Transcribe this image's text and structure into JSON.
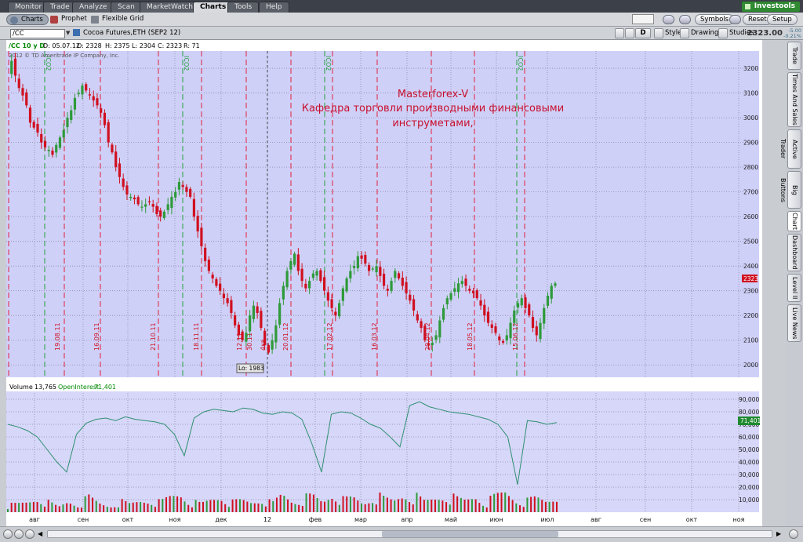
{
  "top_tabs": [
    {
      "label": "Monitor"
    },
    {
      "label": "Trade"
    },
    {
      "label": "Analyze"
    },
    {
      "label": "Scan"
    },
    {
      "label": "MarketWatch"
    },
    {
      "label": "Charts",
      "active": true
    },
    {
      "label": "Tools"
    },
    {
      "label": "Help"
    }
  ],
  "brand": "Investools",
  "sub_tabs": [
    {
      "label": "Charts",
      "active": true
    },
    {
      "label": "Prophet"
    },
    {
      "label": "Flexible Grid"
    }
  ],
  "sub_buttons": {
    "symbols": "Symbols",
    "reset": "Reset",
    "setup": "Setup"
  },
  "symbol_bar": {
    "symbol": "/CC",
    "description": "Cocoa Futures,ETH (SEP2 12)",
    "period": "D",
    "style": "Style",
    "drawings": "Drawings",
    "studies": "Studies",
    "last_price": "2323.00",
    "change_abs": "-5.00",
    "change_pct": "-0.21%"
  },
  "info_bar": {
    "agg": "/CC 10 y D",
    "date": "D: 05.07.12",
    "open": "O: 2328",
    "high": "H: 2375",
    "low": "L: 2304",
    "close": "C: 2323",
    "range": "R: 71",
    "copyright": "2012 © TD Ameritrade IP Company, Inc."
  },
  "annotation": {
    "line1": "Masterforex-V",
    "line2": "Кафедра торговли производными финансовыми",
    "line3": "инструметами,"
  },
  "low_label": "Lo: 1983",
  "price_tag": "2323",
  "date_marks": [
    "19.08.11",
    "16.09.11",
    "21.10.11",
    "18.11.11",
    "12.11",
    "30.11",
    "4кв",
    "20.01.12",
    "17.02.12",
    "16.03.12",
    "20.04.12",
    "18.05.12",
    "15.06.12"
  ],
  "vertical_texts": [
    "ICO2",
    "ICO2",
    "ICO2",
    "ICO2"
  ],
  "volume_header": {
    "volume_label": "Volume",
    "volume_value": "13,765",
    "oi_label": "OpenInterest",
    "oi_value": "71,401"
  },
  "oi_tag": "71,401",
  "x_labels": [
    "авг",
    "сен",
    "окт",
    "ноя",
    "дек",
    "12",
    "фев",
    "мар",
    "апр",
    "май",
    "июн",
    "июл",
    "авг",
    "сен",
    "окт",
    "ноя"
  ],
  "side_tabs": [
    "Trade",
    "Times And Sales",
    "Active Trader",
    "Big Buttons",
    "Chart",
    "Dashboard",
    "Level II",
    "Live News"
  ],
  "colors": {
    "up": "#2e9a3a",
    "down": "#d01020",
    "bg_price": "#cfd0f8",
    "bg_vol": "#d6d7f9",
    "grid": "#777777",
    "vline_red": "#e0203a",
    "vline_green": "#23a23a",
    "annotation": "#c8102e",
    "oi_line": "#2f8f6f"
  },
  "chart_data": [
    {
      "type": "candlestick",
      "title": "/CC 10 y D",
      "ylim": [
        1950,
        3270
      ],
      "yticks": [
        2000,
        2100,
        2200,
        2300,
        2400,
        2500,
        2600,
        2700,
        2800,
        2900,
        3000,
        3100,
        3200
      ],
      "close_series": [
        3180,
        3230,
        3170,
        3120,
        3090,
        3050,
        2980,
        2960,
        2940,
        2900,
        2880,
        2870,
        2850,
        2890,
        2920,
        2950,
        3000,
        3030,
        3080,
        3100,
        3130,
        3110,
        3090,
        3070,
        3050,
        3020,
        2970,
        2900,
        2860,
        2800,
        2760,
        2720,
        2690,
        2680,
        2670,
        2650,
        2640,
        2650,
        2660,
        2640,
        2610,
        2600,
        2620,
        2650,
        2680,
        2700,
        2740,
        2720,
        2700,
        2680,
        2600,
        2540,
        2480,
        2420,
        2380,
        2350,
        2320,
        2300,
        2270,
        2250,
        2210,
        2160,
        2120,
        2100,
        2130,
        2200,
        2240,
        2210,
        2150,
        2080,
        2050,
        2100,
        2160,
        2250,
        2320,
        2380,
        2420,
        2450,
        2380,
        2340,
        2310,
        2340,
        2370,
        2380,
        2340,
        2300,
        2260,
        2230,
        2200,
        2250,
        2310,
        2350,
        2380,
        2400,
        2440,
        2430,
        2410,
        2380,
        2390,
        2400,
        2360,
        2320,
        2300,
        2340,
        2380,
        2350,
        2320,
        2290,
        2260,
        2220,
        2180,
        2150,
        2100,
        2080,
        2090,
        2120,
        2180,
        2230,
        2270,
        2290,
        2310,
        2330,
        2340,
        2320,
        2300,
        2290,
        2270,
        2240,
        2200,
        2170,
        2150,
        2130,
        2100,
        2090,
        2120,
        2170,
        2220,
        2250,
        2270,
        2230,
        2200,
        2150,
        2120,
        2170,
        2230,
        2280,
        2320,
        2330
      ]
    },
    {
      "type": "line",
      "title": "Volume / OpenInterest",
      "ylim": [
        0,
        95000
      ],
      "yticks": [
        10000,
        20000,
        30000,
        40000,
        50000,
        60000,
        70000,
        80000,
        90000
      ],
      "series": [
        {
          "name": "OpenInterest",
          "values": [
            70000,
            68000,
            65000,
            60000,
            50000,
            40000,
            32000,
            62000,
            71000,
            74000,
            75000,
            73000,
            76000,
            74000,
            73000,
            72000,
            70000,
            62000,
            45000,
            75000,
            80000,
            82000,
            81000,
            80000,
            83000,
            82000,
            79000,
            78000,
            80000,
            79000,
            74000,
            55000,
            32000,
            78000,
            80000,
            79000,
            75000,
            70000,
            67000,
            60000,
            52000,
            85000,
            88000,
            84000,
            82000,
            80000,
            79000,
            78000,
            76000,
            74000,
            70000,
            60000,
            22000,
            73000,
            72000,
            70000,
            71401
          ]
        },
        {
          "name": "Volume",
          "values": [
            5000,
            6000,
            8000,
            12000,
            7000,
            4000,
            9000,
            6000,
            11000,
            7000,
            5000,
            8000,
            6000,
            9000,
            10000,
            7000,
            12000,
            15000,
            8000,
            6000,
            10000,
            13000,
            7000,
            9000,
            8000,
            11000,
            6000,
            14000,
            9000,
            10000,
            12000,
            8000,
            16000,
            9000,
            11000,
            7000,
            13000,
            10000,
            9000,
            15000,
            12000,
            8000,
            11000,
            14000,
            10000,
            9000,
            13000,
            7000,
            12000,
            16000,
            10000,
            8000,
            11000,
            9000,
            13765
          ]
        }
      ]
    }
  ]
}
